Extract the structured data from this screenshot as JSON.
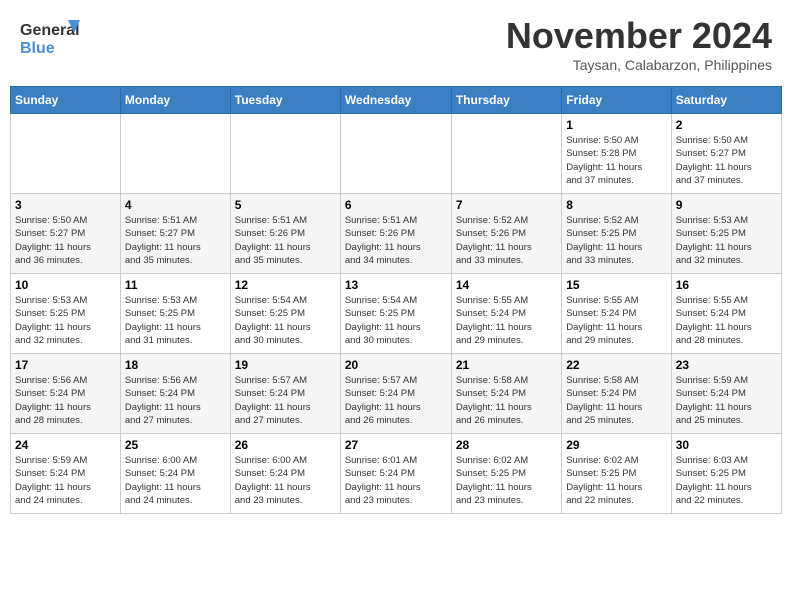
{
  "header": {
    "logo_line1": "General",
    "logo_line2": "Blue",
    "month": "November 2024",
    "location": "Taysan, Calabarzon, Philippines"
  },
  "weekdays": [
    "Sunday",
    "Monday",
    "Tuesday",
    "Wednesday",
    "Thursday",
    "Friday",
    "Saturday"
  ],
  "weeks": [
    [
      {
        "day": "",
        "info": ""
      },
      {
        "day": "",
        "info": ""
      },
      {
        "day": "",
        "info": ""
      },
      {
        "day": "",
        "info": ""
      },
      {
        "day": "",
        "info": ""
      },
      {
        "day": "1",
        "info": "Sunrise: 5:50 AM\nSunset: 5:28 PM\nDaylight: 11 hours\nand 37 minutes."
      },
      {
        "day": "2",
        "info": "Sunrise: 5:50 AM\nSunset: 5:27 PM\nDaylight: 11 hours\nand 37 minutes."
      }
    ],
    [
      {
        "day": "3",
        "info": "Sunrise: 5:50 AM\nSunset: 5:27 PM\nDaylight: 11 hours\nand 36 minutes."
      },
      {
        "day": "4",
        "info": "Sunrise: 5:51 AM\nSunset: 5:27 PM\nDaylight: 11 hours\nand 35 minutes."
      },
      {
        "day": "5",
        "info": "Sunrise: 5:51 AM\nSunset: 5:26 PM\nDaylight: 11 hours\nand 35 minutes."
      },
      {
        "day": "6",
        "info": "Sunrise: 5:51 AM\nSunset: 5:26 PM\nDaylight: 11 hours\nand 34 minutes."
      },
      {
        "day": "7",
        "info": "Sunrise: 5:52 AM\nSunset: 5:26 PM\nDaylight: 11 hours\nand 33 minutes."
      },
      {
        "day": "8",
        "info": "Sunrise: 5:52 AM\nSunset: 5:25 PM\nDaylight: 11 hours\nand 33 minutes."
      },
      {
        "day": "9",
        "info": "Sunrise: 5:53 AM\nSunset: 5:25 PM\nDaylight: 11 hours\nand 32 minutes."
      }
    ],
    [
      {
        "day": "10",
        "info": "Sunrise: 5:53 AM\nSunset: 5:25 PM\nDaylight: 11 hours\nand 32 minutes."
      },
      {
        "day": "11",
        "info": "Sunrise: 5:53 AM\nSunset: 5:25 PM\nDaylight: 11 hours\nand 31 minutes."
      },
      {
        "day": "12",
        "info": "Sunrise: 5:54 AM\nSunset: 5:25 PM\nDaylight: 11 hours\nand 30 minutes."
      },
      {
        "day": "13",
        "info": "Sunrise: 5:54 AM\nSunset: 5:25 PM\nDaylight: 11 hours\nand 30 minutes."
      },
      {
        "day": "14",
        "info": "Sunrise: 5:55 AM\nSunset: 5:24 PM\nDaylight: 11 hours\nand 29 minutes."
      },
      {
        "day": "15",
        "info": "Sunrise: 5:55 AM\nSunset: 5:24 PM\nDaylight: 11 hours\nand 29 minutes."
      },
      {
        "day": "16",
        "info": "Sunrise: 5:55 AM\nSunset: 5:24 PM\nDaylight: 11 hours\nand 28 minutes."
      }
    ],
    [
      {
        "day": "17",
        "info": "Sunrise: 5:56 AM\nSunset: 5:24 PM\nDaylight: 11 hours\nand 28 minutes."
      },
      {
        "day": "18",
        "info": "Sunrise: 5:56 AM\nSunset: 5:24 PM\nDaylight: 11 hours\nand 27 minutes."
      },
      {
        "day": "19",
        "info": "Sunrise: 5:57 AM\nSunset: 5:24 PM\nDaylight: 11 hours\nand 27 minutes."
      },
      {
        "day": "20",
        "info": "Sunrise: 5:57 AM\nSunset: 5:24 PM\nDaylight: 11 hours\nand 26 minutes."
      },
      {
        "day": "21",
        "info": "Sunrise: 5:58 AM\nSunset: 5:24 PM\nDaylight: 11 hours\nand 26 minutes."
      },
      {
        "day": "22",
        "info": "Sunrise: 5:58 AM\nSunset: 5:24 PM\nDaylight: 11 hours\nand 25 minutes."
      },
      {
        "day": "23",
        "info": "Sunrise: 5:59 AM\nSunset: 5:24 PM\nDaylight: 11 hours\nand 25 minutes."
      }
    ],
    [
      {
        "day": "24",
        "info": "Sunrise: 5:59 AM\nSunset: 5:24 PM\nDaylight: 11 hours\nand 24 minutes."
      },
      {
        "day": "25",
        "info": "Sunrise: 6:00 AM\nSunset: 5:24 PM\nDaylight: 11 hours\nand 24 minutes."
      },
      {
        "day": "26",
        "info": "Sunrise: 6:00 AM\nSunset: 5:24 PM\nDaylight: 11 hours\nand 23 minutes."
      },
      {
        "day": "27",
        "info": "Sunrise: 6:01 AM\nSunset: 5:24 PM\nDaylight: 11 hours\nand 23 minutes."
      },
      {
        "day": "28",
        "info": "Sunrise: 6:02 AM\nSunset: 5:25 PM\nDaylight: 11 hours\nand 23 minutes."
      },
      {
        "day": "29",
        "info": "Sunrise: 6:02 AM\nSunset: 5:25 PM\nDaylight: 11 hours\nand 22 minutes."
      },
      {
        "day": "30",
        "info": "Sunrise: 6:03 AM\nSunset: 5:25 PM\nDaylight: 11 hours\nand 22 minutes."
      }
    ]
  ]
}
